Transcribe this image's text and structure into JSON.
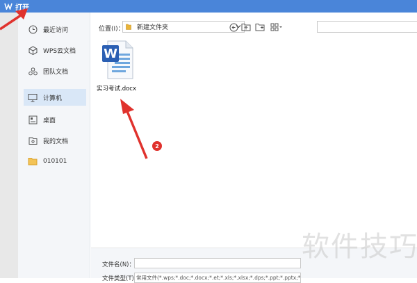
{
  "window": {
    "title": "打开"
  },
  "sidebar": {
    "items": [
      {
        "label": "最近访问",
        "icon": "clock-icon"
      },
      {
        "label": "WPS云文档",
        "icon": "cube-icon"
      },
      {
        "label": "团队文档",
        "icon": "team-icon"
      },
      {
        "label": "计算机",
        "icon": "monitor-icon",
        "active": true
      },
      {
        "label": "桌面",
        "icon": "desktop-icon"
      },
      {
        "label": "我的文档",
        "icon": "my-docs-icon"
      },
      {
        "label": "010101",
        "icon": "folder-icon"
      }
    ]
  },
  "toolbar": {
    "location_label": "位置(I)：",
    "location_value": "新建文件夹"
  },
  "files": [
    {
      "name": "实习考试.docx",
      "icon": "word-doc-icon"
    }
  ],
  "annotations": {
    "step_badge": "2",
    "arrow_color": "#e0322d"
  },
  "bottom": {
    "filename_label": "文件名(N)：",
    "filename_value": "",
    "filetype_label": "文件类型(T)：",
    "filetype_value": "常用文件(*.wps;*.doc;*.docx;*.et;*.xls;*.xlsx;*.dps;*.ppt;*.pptx;*.pdf)"
  },
  "watermark": "软件技巧",
  "colors": {
    "titlebar": "#4a85d9",
    "active_item": "#d9e7f7",
    "badge": "#e0322d"
  }
}
